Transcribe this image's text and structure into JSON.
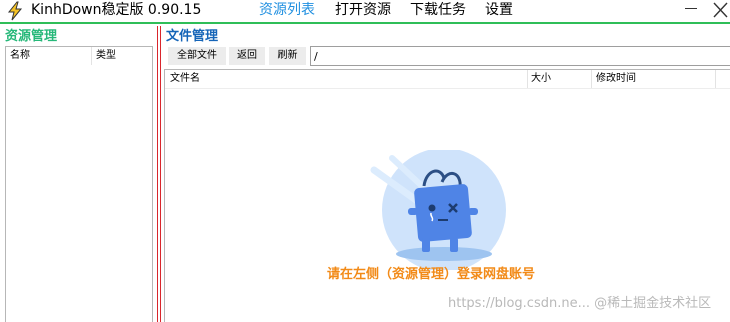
{
  "window": {
    "title": "KinhDown稳定版 0.90.15",
    "icon": "lightning-icon",
    "minimize_icon": "minimize-icon",
    "close_icon": "close-icon"
  },
  "nav": [
    {
      "label": "资源列表",
      "active": true
    },
    {
      "label": "打开资源",
      "active": false
    },
    {
      "label": "下载任务",
      "active": false
    },
    {
      "label": "设置",
      "active": false
    }
  ],
  "left_panel": {
    "title": "资源管理",
    "columns": [
      "名称",
      "类型"
    ]
  },
  "right_panel": {
    "title": "文件管理",
    "toolbar": {
      "all_files": "全部文件",
      "back": "返回",
      "refresh": "刷新"
    },
    "path_value": "/",
    "columns": [
      "文件名",
      "大小",
      "修改时间"
    ],
    "empty_hint": "请在左侧（资源管理）登录网盘账号",
    "empty_illustration": "sad-bag-icon"
  },
  "watermark": "https://blog.csdn.ne... @稀土掘金技术社区",
  "colors": {
    "accent_nav": "#1f8fe0",
    "title_green": "#26b879",
    "title_blue": "#1565b8",
    "divider_red": "#d9262c",
    "top_line": "#2fbe58",
    "hint_orange": "#f28a17"
  }
}
